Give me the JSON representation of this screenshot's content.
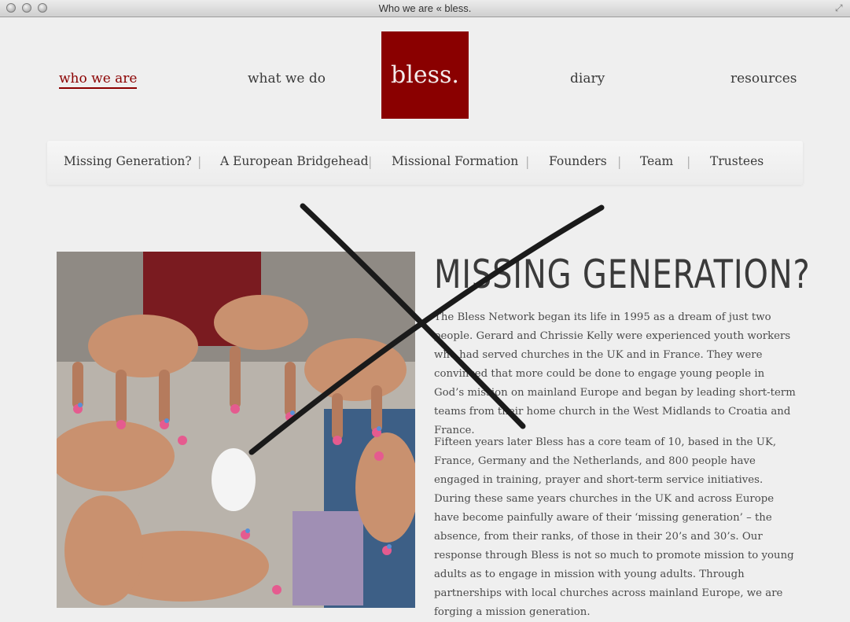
{
  "window": {
    "title": "Who we are « bless."
  },
  "nav": {
    "who": "who we are",
    "what": "what we do",
    "logo": "bless.",
    "diary": "diary",
    "resources": "resources"
  },
  "subnav": {
    "items": [
      "Missing Generation?",
      "A European Bridgehead",
      "Missional Formation",
      "Founders",
      "Team",
      "Trustees"
    ]
  },
  "article": {
    "heading": "MISSING GENERATION?",
    "p1": "The Bless Network began its life in 1995 as a dream of just two people. Gerard and Chrissie Kelly were experienced youth workers who had served churches in the UK and in France. They were convinced that more could be done to engage young people in God’s mission on mainland Europe and began by leading short-term teams from their home church in the West Midlands to Croatia and France.",
    "p2": "Fifteen years later Bless has a core team of 10, based in the UK, France, Germany and the Netherlands, and 800 people have engaged in training, prayer and short-term service initiatives. During these same years churches in the UK and across Europe have become painfully aware of their ‘missing generation’ – the absence, from their ranks, of those in their 20’s and 30’s. Our response through Bless is not so much to promote mission to young adults as to engage in mission with young adults. Through partnerships with local churches across mainland Europe, we are forging a mission generation."
  },
  "colors": {
    "brand": "#8a0000",
    "text": "#3a3a3a",
    "background": "#efefef"
  }
}
